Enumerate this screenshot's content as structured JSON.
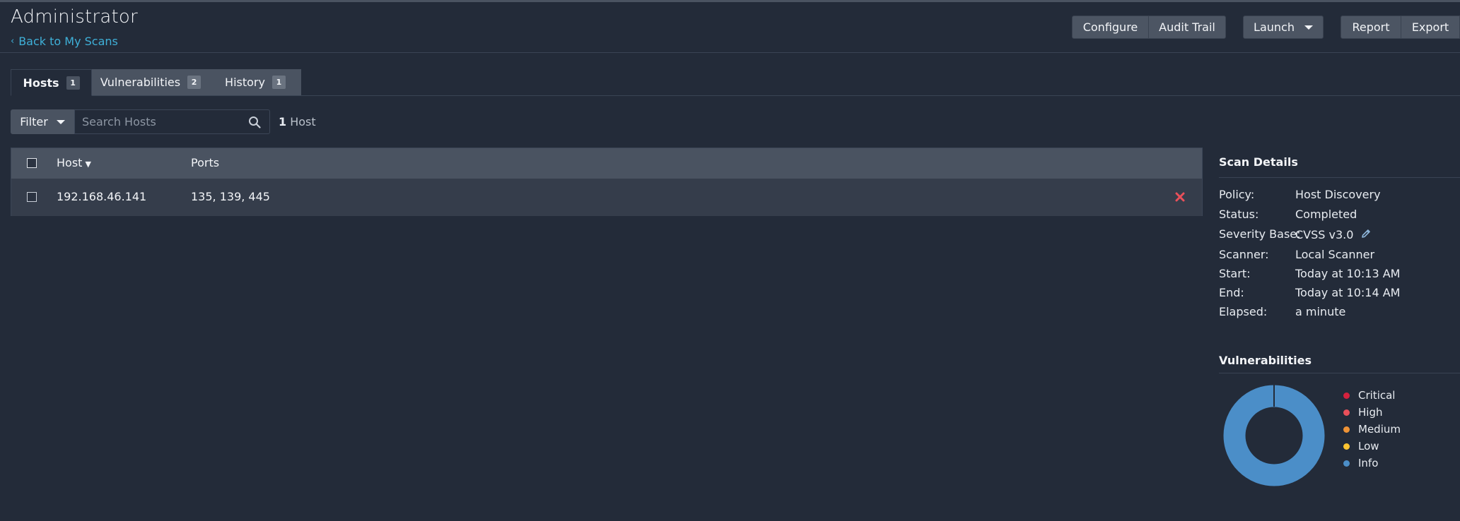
{
  "header": {
    "title": "Administrator",
    "back_label": "Back to My Scans",
    "buttons": {
      "configure": "Configure",
      "audit_trail": "Audit Trail",
      "launch": "Launch",
      "report": "Report",
      "export": "Export"
    }
  },
  "tabs": [
    {
      "label": "Hosts",
      "count": "1",
      "active": true
    },
    {
      "label": "Vulnerabilities",
      "count": "2",
      "active": false
    },
    {
      "label": "History",
      "count": "1",
      "active": false
    }
  ],
  "filter": {
    "label": "Filter",
    "search_placeholder": "Search Hosts",
    "result_count": "1",
    "result_unit": "Host"
  },
  "table": {
    "columns": {
      "host": "Host",
      "ports": "Ports"
    },
    "rows": [
      {
        "host": "192.168.46.141",
        "ports": "135, 139, 445"
      }
    ]
  },
  "scan_details": {
    "title": "Scan Details",
    "fields": [
      {
        "label": "Policy:",
        "value": "Host Discovery"
      },
      {
        "label": "Status:",
        "value": "Completed"
      },
      {
        "label": "Severity Base:",
        "value": "CVSS v3.0"
      },
      {
        "label": "Scanner:",
        "value": "Local Scanner"
      },
      {
        "label": "Start:",
        "value": "Today at 10:13 AM"
      },
      {
        "label": "End:",
        "value": "Today at 10:14 AM"
      },
      {
        "label": "Elapsed:",
        "value": "a minute"
      }
    ]
  },
  "vulnerabilities": {
    "title": "Vulnerabilities",
    "legend": [
      {
        "label": "Critical",
        "color": "#d4213d"
      },
      {
        "label": "High",
        "color": "#e9505a"
      },
      {
        "label": "Medium",
        "color": "#ee9336"
      },
      {
        "label": "Low",
        "color": "#fdc431"
      },
      {
        "label": "Info",
        "color": "#4b8ec8"
      }
    ],
    "counts": {
      "Critical": 0,
      "High": 0,
      "Medium": 0,
      "Low": 0,
      "Info": 1
    }
  },
  "colors": {
    "background": "#232b39",
    "accent_link": "#3fb0d8",
    "remove": "#e9505a"
  }
}
